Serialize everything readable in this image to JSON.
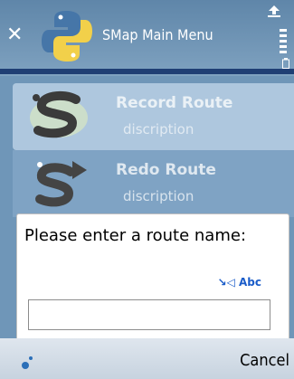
{
  "app": {
    "title": "SMap Main Menu"
  },
  "menu": {
    "items": [
      {
        "label": "Record Route",
        "desc": "discription",
        "icon": "smap-logo-icon"
      },
      {
        "label": "Redo Route",
        "desc": "discription",
        "icon": "smap-arrow-logo-icon"
      }
    ]
  },
  "dialog": {
    "prompt": "Please enter a route name:",
    "input_mode": "Abc",
    "input_value": ""
  },
  "softkeys": {
    "right_label": "Cancel"
  },
  "colors": {
    "accent": "#1f3f74",
    "input_mode": "#1a5cc9"
  }
}
